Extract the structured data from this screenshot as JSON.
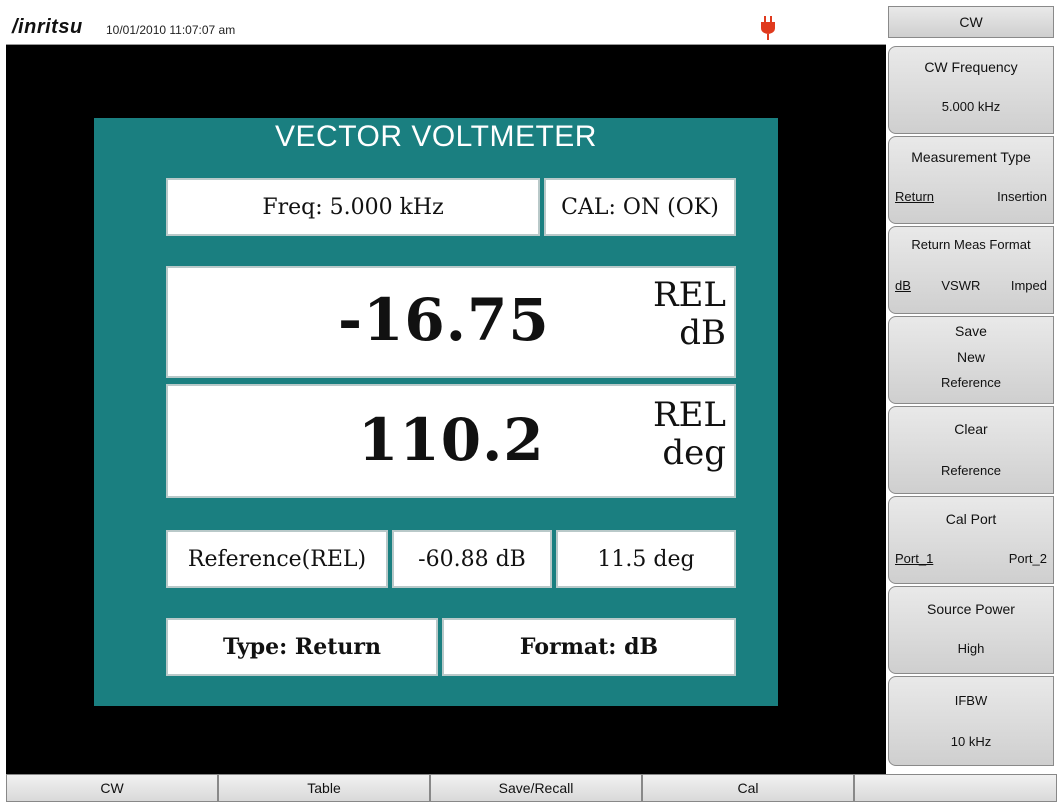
{
  "status": {
    "brand": "/inritsu",
    "datetime": "10/01/2010 11:07:07 am"
  },
  "panel": {
    "title": "VECTOR VOLTMETER",
    "freq": "Freq: 5.000 kHz",
    "cal": "CAL: ON (OK)",
    "magnitude": "-16.75",
    "magnitude_unit_1": "REL",
    "magnitude_unit_2": "dB",
    "phase": "110.2",
    "phase_unit_1": "REL",
    "phase_unit_2": "deg",
    "reference_label": "Reference(REL)",
    "reference_mag": "-60.88 dB",
    "reference_phase": "11.5 deg",
    "type": "Type: Return",
    "format": "Format: dB"
  },
  "softkeys": {
    "header": "CW",
    "cw_frequency": {
      "label": "CW Frequency",
      "value": "5.000 kHz"
    },
    "measurement_type": {
      "label": "Measurement Type",
      "options": [
        "Return",
        "Insertion"
      ],
      "selected": "Return"
    },
    "return_meas_format": {
      "label": "Return Meas Format",
      "options": [
        "dB",
        "VSWR",
        "Imped"
      ],
      "selected": "dB"
    },
    "save_reference": {
      "line1": "Save",
      "line2": "New",
      "line3": "Reference"
    },
    "clear_reference": {
      "line1": "Clear",
      "line2": "Reference"
    },
    "cal_port": {
      "label": "Cal Port",
      "options": [
        "Port_1",
        "Port_2"
      ],
      "selected": "Port_1"
    },
    "source_power": {
      "label": "Source Power",
      "value": "High"
    },
    "ifbw": {
      "label": "IFBW",
      "value": "10 kHz"
    }
  },
  "bottom_menu": [
    "CW",
    "Table",
    "Save/Recall",
    "Cal"
  ],
  "colors": {
    "panel": "#1a7f80",
    "power_icon": "#e03a1e"
  }
}
